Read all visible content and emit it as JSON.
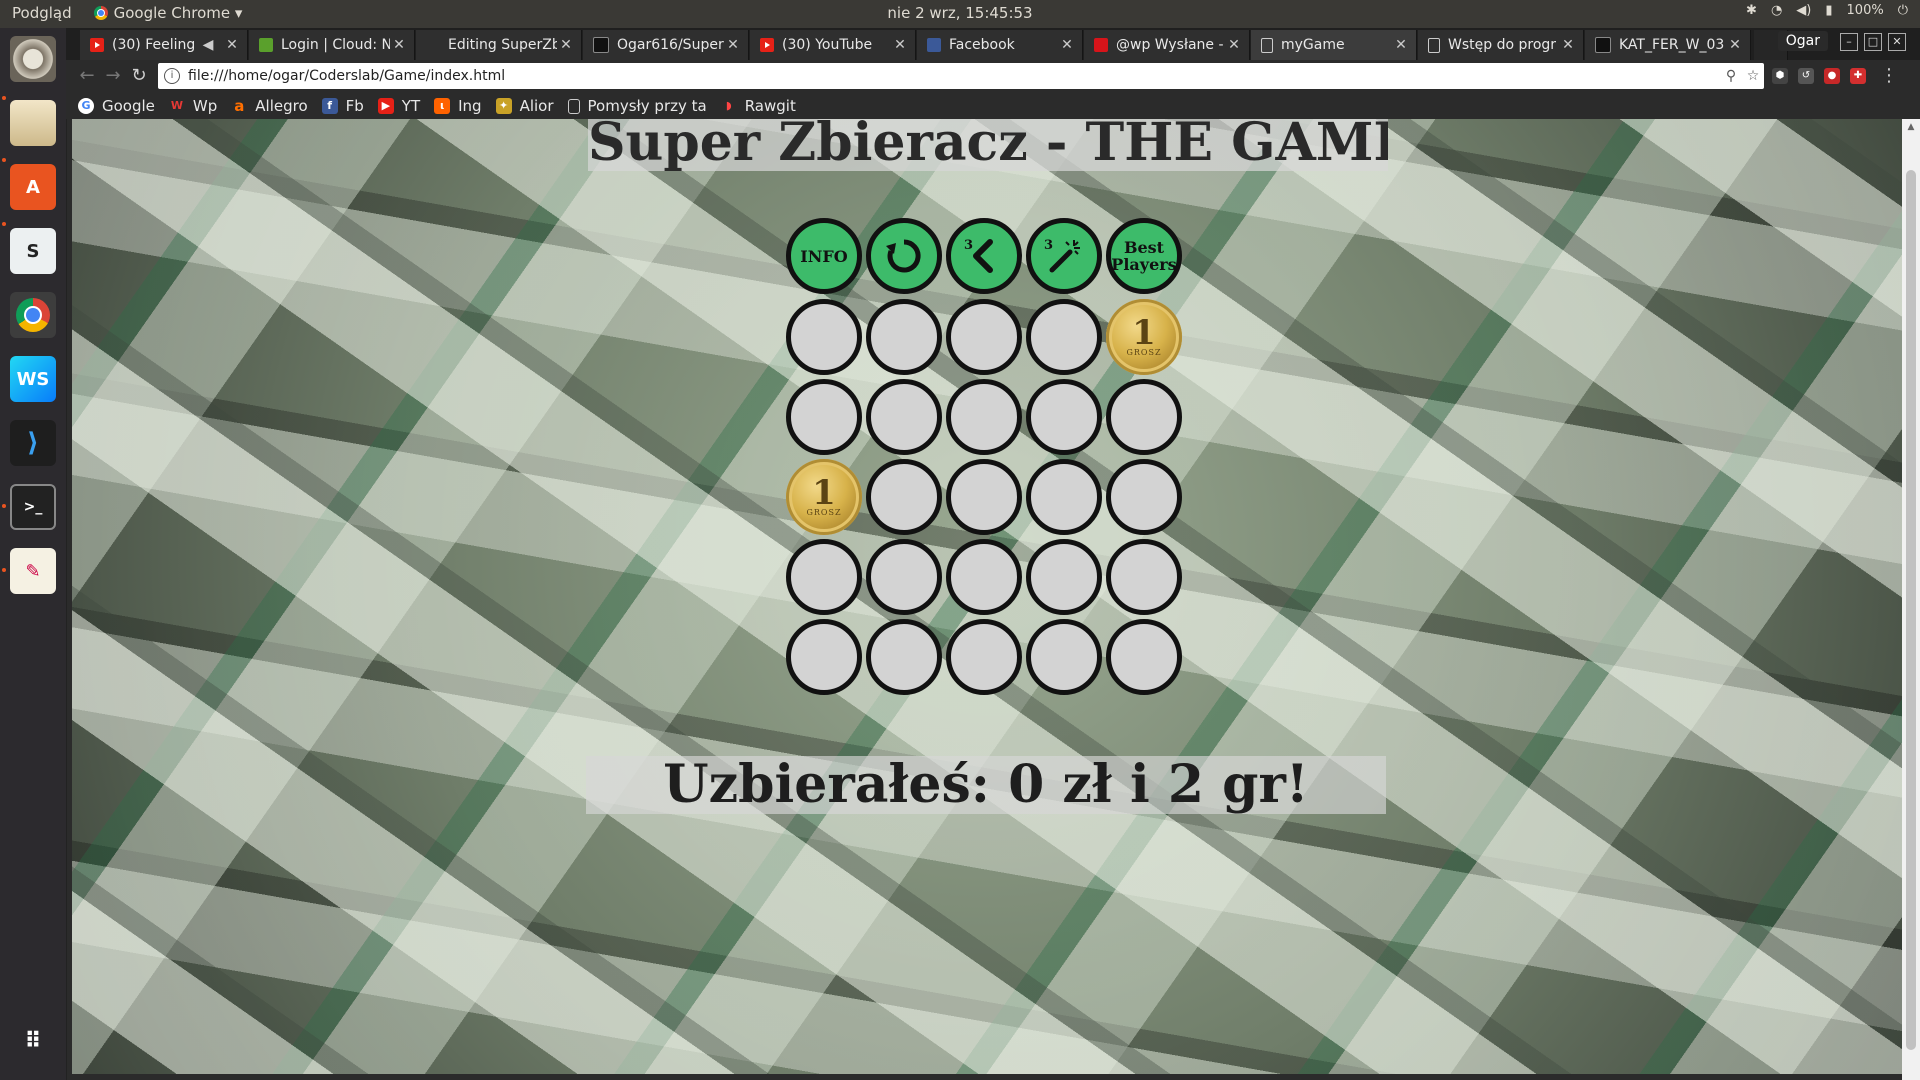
{
  "system_bar": {
    "app_label": "Podgląd",
    "active_app": "Google Chrome",
    "clock": "nie 2 wrz, 15:45:53",
    "battery": "100%"
  },
  "browser": {
    "tabs": [
      {
        "title": "(30) Feeling",
        "favicon": "youtube-icon",
        "active": false
      },
      {
        "title": "Login | Cloud: N",
        "favicon": "leaf-icon",
        "active": false
      },
      {
        "title": "Editing SuperZb",
        "favicon": "none",
        "active": false
      },
      {
        "title": "Ogar616/Super",
        "favicon": "github-icon",
        "active": false
      },
      {
        "title": "(30) YouTube",
        "favicon": "youtube-icon",
        "active": false
      },
      {
        "title": "Facebook",
        "favicon": "facebook-icon",
        "active": false
      },
      {
        "title": "@wp Wysłane -",
        "favicon": "wp-icon",
        "active": false
      },
      {
        "title": "myGame",
        "favicon": "document-icon",
        "active": true
      },
      {
        "title": "Wstęp do progr",
        "favicon": "document-icon",
        "active": false
      },
      {
        "title": "KAT_FER_W_03",
        "favicon": "github-icon",
        "active": false
      }
    ],
    "profile": "Ogar",
    "url": "file:///home/ogar/Coderslab/Game/index.html",
    "bookmarks": [
      {
        "label": "Google",
        "icon": "google-icon"
      },
      {
        "label": "Wp",
        "icon": "wp-icon"
      },
      {
        "label": "Allegro",
        "icon": "allegro-icon"
      },
      {
        "label": "Fb",
        "icon": "facebook-icon"
      },
      {
        "label": "YT",
        "icon": "youtube-icon"
      },
      {
        "label": "Ing",
        "icon": "ing-icon"
      },
      {
        "label": "Alior",
        "icon": "alior-icon"
      },
      {
        "label": "Pomysły przy ta",
        "icon": "document-icon"
      },
      {
        "label": "Rawgit",
        "icon": "rawgit-icon"
      }
    ]
  },
  "game": {
    "title": "Super Zbieracz - THE GAME !!!",
    "controls": {
      "info": "INFO",
      "reset": "reset-icon",
      "undo_count": "3",
      "magic_count": "3",
      "best_players": "Best Players"
    },
    "coin_label": "1",
    "coin_word": "GROSZ",
    "grid": [
      [
        "empty",
        "empty",
        "empty",
        "empty",
        "coin"
      ],
      [
        "empty",
        "empty",
        "empty",
        "empty",
        "empty"
      ],
      [
        "coin",
        "empty",
        "empty",
        "empty",
        "empty"
      ],
      [
        "empty",
        "empty",
        "empty",
        "empty",
        "empty"
      ],
      [
        "empty",
        "empty",
        "empty",
        "empty",
        "empty"
      ]
    ],
    "score": "Uzbierałeś: 0 zł i 2 gr!"
  },
  "colors": {
    "button_green": "#3dbb6a",
    "cell_gray": "#d3d3d3",
    "coin_gold": "#d7b24a"
  }
}
